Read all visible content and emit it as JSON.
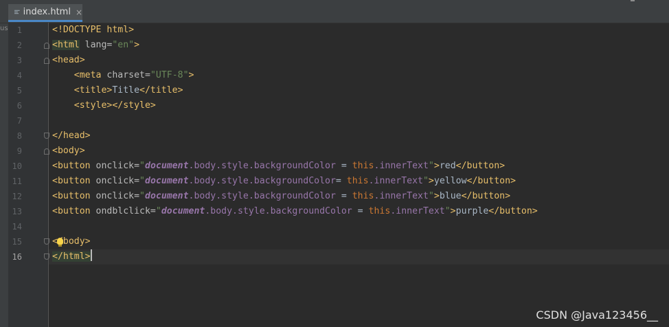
{
  "tab": {
    "label": "index.html",
    "close": "×"
  },
  "left_strip": {
    "text": "us"
  },
  "current_line": 16,
  "line_numbers": [
    "1",
    "2",
    "3",
    "4",
    "5",
    "6",
    "7",
    "8",
    "9",
    "10",
    "11",
    "12",
    "13",
    "14",
    "15",
    "16"
  ],
  "code": {
    "l1": [
      "<!DOCTYPE html>"
    ],
    "l2": [
      "<html",
      " lang=",
      "\"en\"",
      ">"
    ],
    "l3": [
      "<head>"
    ],
    "l4": [
      "    ",
      "<meta",
      " charset=",
      "\"UTF-8\"",
      ">"
    ],
    "l5": [
      "    ",
      "<title>",
      "Title",
      "</title>"
    ],
    "l6": [
      "    ",
      "<style>",
      "</style>"
    ],
    "l8": [
      "</head>"
    ],
    "l9": [
      "<body>"
    ],
    "l10": [
      "<button",
      " onclick=",
      "\"",
      "document",
      ".body.style.backgroundColor",
      " = ",
      "this",
      ".innerText",
      "\"",
      ">",
      "red",
      "</button>"
    ],
    "l11": [
      "<button",
      " onclick=",
      "\"",
      "document",
      ".body.style.backgroundColor",
      "= ",
      "this",
      ".innerText",
      "\"",
      ">",
      "yellow",
      "</button>"
    ],
    "l12": [
      "<button",
      " onclick=",
      "\"",
      "document",
      ".body.style.backgroundColor",
      " = ",
      "this",
      ".innerText",
      "\"",
      ">",
      "blue",
      "</button>"
    ],
    "l13": [
      "<button",
      " ondblclick=",
      "\"",
      "document",
      ".body.style.backgroundColor",
      " = ",
      "this",
      ".innerText",
      "\"",
      ">",
      "purple",
      "</button>"
    ],
    "l15": [
      "</body>"
    ],
    "l16": [
      "</html>"
    ]
  },
  "watermark": "CSDN @Java123456__",
  "icons": {
    "tab_icon": "html-file-icon",
    "bulb": "lightbulb-icon",
    "fold": "fold-marker-icon"
  },
  "colors": {
    "tag": "#e8bf6a",
    "attr": "#bababa",
    "string": "#6a8759",
    "keyword": "#cc7832",
    "document": "#9876aa",
    "editor_bg": "#2b2b2b",
    "tab_underline": "#4a88c7"
  }
}
